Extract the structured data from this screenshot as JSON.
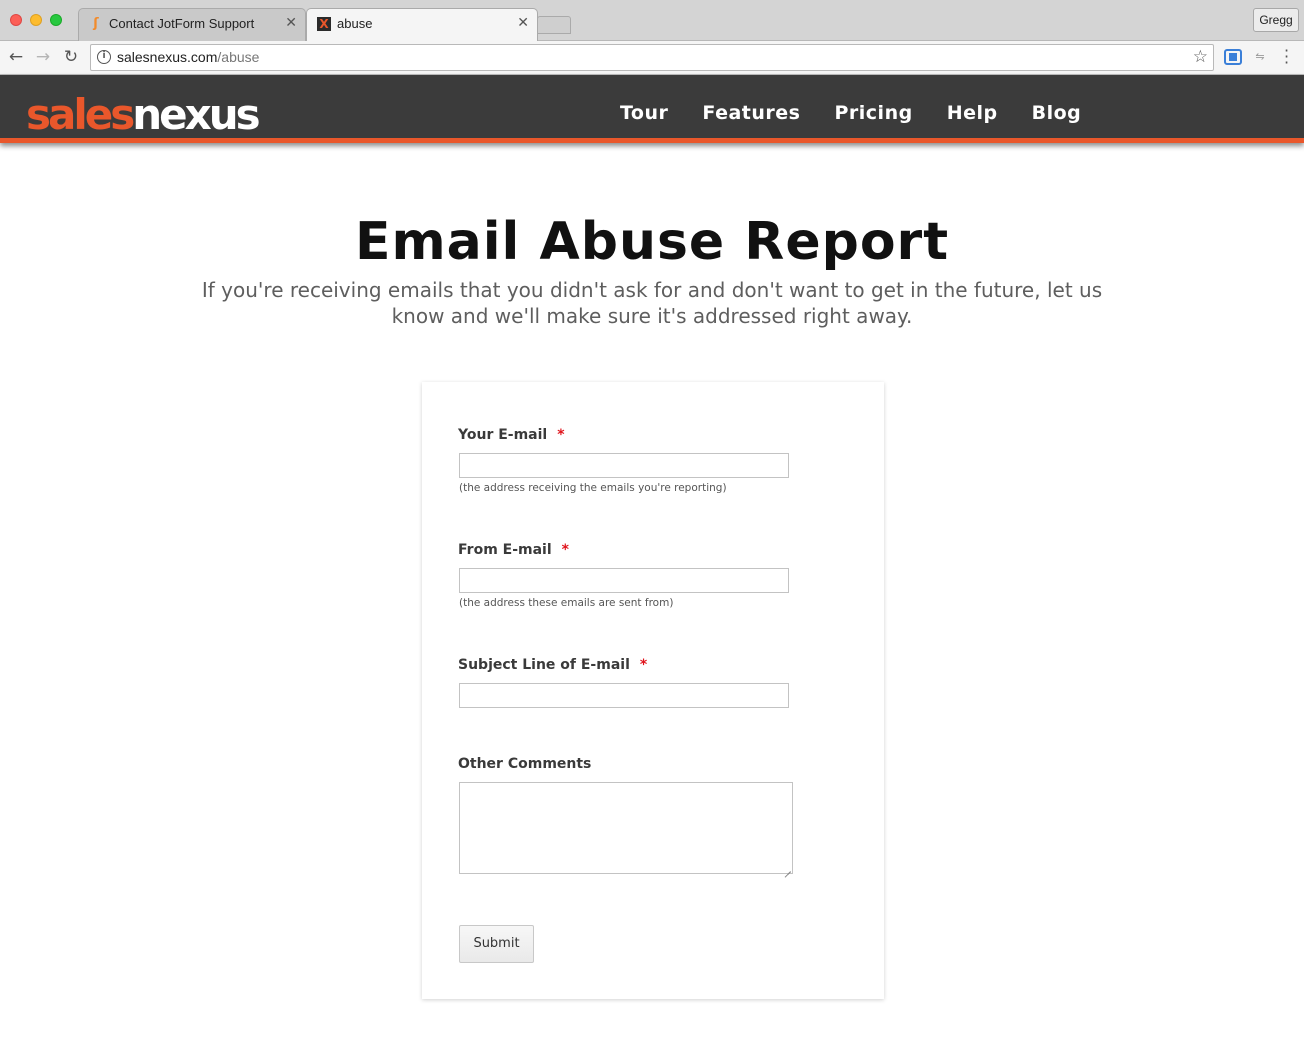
{
  "browser": {
    "tabs": [
      {
        "title": "Contact JotForm Support",
        "active": false
      },
      {
        "title": "abuse",
        "active": true
      }
    ],
    "profile_name": "Gregg",
    "url_domain": "salesnexus.com",
    "url_path": "/abuse"
  },
  "site": {
    "logo_part1": "sales",
    "logo_part2": "nexus",
    "brand_color": "#e9572b",
    "nav": [
      {
        "label": "Tour"
      },
      {
        "label": "Features"
      },
      {
        "label": "Pricing"
      },
      {
        "label": "Help"
      },
      {
        "label": "Blog"
      }
    ]
  },
  "page": {
    "title": "Email Abuse Report",
    "subtitle": "If you're receiving emails that you didn't ask for and don't want to get in the future, let us know and we'll make sure it's addressed right away."
  },
  "form": {
    "fields": [
      {
        "label": "Your E-mail",
        "required_marker": "*",
        "value": "",
        "hint": "(the address receiving the emails you're reporting)"
      },
      {
        "label": "From E-mail",
        "required_marker": "*",
        "value": "",
        "hint": "(the address these emails are sent from)"
      },
      {
        "label": "Subject Line of E-mail",
        "required_marker": "*",
        "value": ""
      },
      {
        "label": "Other Comments",
        "value": ""
      }
    ],
    "submit_label": "Submit"
  }
}
